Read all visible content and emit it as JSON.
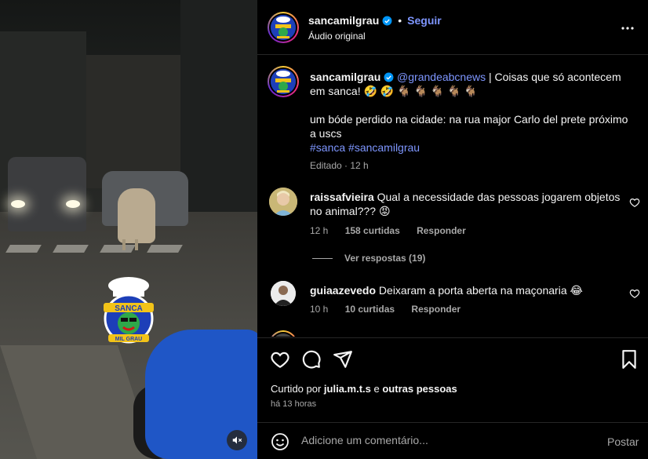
{
  "media": {
    "mute_icon": "speaker-muted-icon",
    "sticker_text_top": "SANCA",
    "sticker_text_bottom": "MIL GRAU"
  },
  "header": {
    "username": "sancamilgrau",
    "follow_label": "Seguir",
    "separator": "•",
    "audio_label": "Áudio original",
    "more_icon": "more-horizontal-icon"
  },
  "caption": {
    "username": "sancamilgrau",
    "mention": "@grandeabcnews",
    "text_line1": " | Coisas que só acontecem em sanca! 🤣 🤣 🐐 🐐 🐐 🐐 🐐",
    "text_line2": "um bóde perdido na cidade: na rua major Carlo del prete próximo a uscs",
    "hashtags": "#sanca #sancamilgrau",
    "edited": "Editado · 12 h"
  },
  "comments": [
    {
      "username": "raissafvieira",
      "text": "Qual a necessidade das pessoas jogarem objetos no animal??? 😡",
      "time": "12 h",
      "likes": "158 curtidas",
      "reply_label": "Responder",
      "view_replies": "Ver respostas (19)"
    },
    {
      "username": "guiaazevedo",
      "text": "Deixaram a porta aberta na maçonaria 😂",
      "time": "10 h",
      "likes": "10 curtidas",
      "reply_label": "Responder"
    }
  ],
  "actions": {
    "liked_prefix": "Curtido por ",
    "liked_user": "julia.m.t.s",
    "liked_mid": " e ",
    "liked_others": "outras pessoas",
    "time_ago": "há 13 horas"
  },
  "comment_box": {
    "placeholder": "Adicione um comentário...",
    "post_label": "Postar"
  },
  "colors": {
    "accent": "#7e96ff",
    "verified": "#0095f6",
    "background": "#000000",
    "secondary_text": "#a8a8a8"
  }
}
